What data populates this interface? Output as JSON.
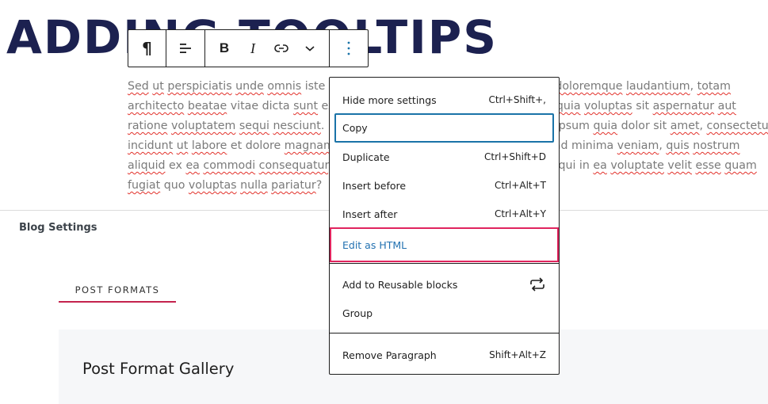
{
  "heading": "ADDING TOOLTIPS",
  "toolbar": {
    "buttons": [
      {
        "name": "paragraph",
        "icon": "pilcrow-icon",
        "label": "Paragraph"
      },
      {
        "name": "align",
        "icon": "align-left-icon",
        "label": "Align"
      },
      {
        "name": "bold",
        "icon": "bold-icon",
        "label": "Bold"
      },
      {
        "name": "italic",
        "icon": "italic-icon",
        "label": "Italic"
      },
      {
        "name": "link",
        "icon": "link-icon",
        "label": "Link"
      },
      {
        "name": "more-rich-text",
        "icon": "chevron-down-icon",
        "label": "More"
      },
      {
        "name": "options",
        "icon": "more-vertical-icon",
        "label": "Options"
      }
    ],
    "bold_glyph": "B",
    "italic_glyph": "I",
    "pilcrow_glyph": "¶"
  },
  "paragraph": {
    "lines": [
      [
        [
          "Sed",
          1
        ],
        [
          " ",
          0
        ],
        [
          "ut",
          1
        ],
        [
          " ",
          0
        ],
        [
          "perspiciatis",
          1
        ],
        [
          " ",
          0
        ],
        [
          "unde",
          1
        ],
        [
          " ",
          0
        ],
        [
          "omnis",
          1
        ],
        [
          " ",
          0
        ],
        [
          "iste natus error sit voluptatem accusantium",
          0
        ],
        [
          " ",
          0
        ],
        [
          "doloremque",
          1
        ],
        [
          " ",
          0
        ],
        [
          "laudantium",
          1
        ],
        [
          ", ",
          0
        ],
        [
          "totam",
          1
        ]
      ],
      [
        [
          "architecto",
          1
        ],
        [
          " ",
          0
        ],
        [
          "beatae",
          1
        ],
        [
          " vitae dicta ",
          0
        ],
        [
          "sunt",
          1
        ],
        [
          " explicabo. Nemo enim ipsam voluptatem ",
          0
        ],
        [
          "quia",
          1
        ],
        [
          " ",
          0
        ],
        [
          "voluptas",
          1
        ],
        [
          " sit ",
          0
        ],
        [
          "aspernatur",
          1
        ],
        [
          " ",
          0
        ],
        [
          "aut",
          1
        ]
      ],
      [
        [
          "ratione",
          1
        ],
        [
          " ",
          0
        ],
        [
          "voluptatem",
          1
        ],
        [
          " ",
          0
        ],
        [
          "sequi",
          1
        ],
        [
          " ",
          0
        ],
        [
          "nesciunt",
          1
        ],
        [
          ". Neque porro quisquam est, qui dolorem ipsum ",
          0
        ],
        [
          "quia",
          1
        ],
        [
          " dolor sit ",
          0
        ],
        [
          "amet",
          1
        ],
        [
          ", ",
          0
        ],
        [
          "consectetur",
          1
        ]
      ],
      [
        [
          "incidunt",
          1
        ],
        [
          " ",
          0
        ],
        [
          "ut",
          1
        ],
        [
          " ",
          0
        ],
        [
          "labore",
          1
        ],
        [
          " et dolore ",
          0
        ],
        [
          "magnam",
          1
        ],
        [
          " aliquam quaerat voluptatem. Ut enim ad minima ",
          0
        ],
        [
          "veniam",
          1
        ],
        [
          ", ",
          0
        ],
        [
          "quis",
          1
        ],
        [
          " ",
          0
        ],
        [
          "nostrum",
          1
        ]
      ],
      [
        [
          "aliquid",
          1
        ],
        [
          " ex ",
          0
        ],
        [
          "ea",
          1
        ],
        [
          " ",
          0
        ],
        [
          "commodi",
          1
        ],
        [
          " ",
          0
        ],
        [
          "consequatur",
          1
        ],
        [
          ". Quis autem vel eum iure reprehenderit qui in ",
          0
        ],
        [
          "ea",
          1
        ],
        [
          " ",
          0
        ],
        [
          "voluptate",
          1
        ],
        [
          " ",
          0
        ],
        [
          "velit",
          1
        ],
        [
          " ",
          0
        ],
        [
          "esse",
          1
        ],
        [
          " ",
          0
        ],
        [
          "quam",
          1
        ]
      ],
      [
        [
          "fugiat",
          1
        ],
        [
          " quo ",
          0
        ],
        [
          "voluptas",
          1
        ],
        [
          " ",
          0
        ],
        [
          "nulla",
          1
        ],
        [
          " ",
          0
        ],
        [
          "pariatur",
          1
        ],
        [
          "?",
          0
        ]
      ]
    ]
  },
  "blog_settings": "Blog Settings",
  "tabs": [
    {
      "label": "POST FORMATS",
      "active": true
    }
  ],
  "panel_title": "Post Format Gallery",
  "menu": {
    "items": [
      {
        "label": "Hide more settings",
        "shortcut": "Ctrl+Shift+,"
      },
      {
        "label": "Copy",
        "shortcut": ""
      },
      {
        "label": "Duplicate",
        "shortcut": "Ctrl+Shift+D"
      },
      {
        "label": "Insert before",
        "shortcut": "Ctrl+Alt+T"
      },
      {
        "label": "Insert after",
        "shortcut": "Ctrl+Alt+Y"
      },
      {
        "label": "Edit as HTML",
        "shortcut": ""
      },
      {
        "label": "Add to Reusable blocks",
        "shortcut": "",
        "icon": "reusable-block-icon"
      },
      {
        "label": "Group",
        "shortcut": ""
      },
      {
        "label": "Remove Paragraph",
        "shortcut": "Shift+Alt+Z"
      }
    ]
  },
  "colors": {
    "heading": "#1c2150",
    "focus": "#1a73a8",
    "highlight_border": "#e0245e",
    "link_text": "#2271b1",
    "tab_underline": "#c4234d",
    "panel_bg": "#f6f7f9"
  }
}
